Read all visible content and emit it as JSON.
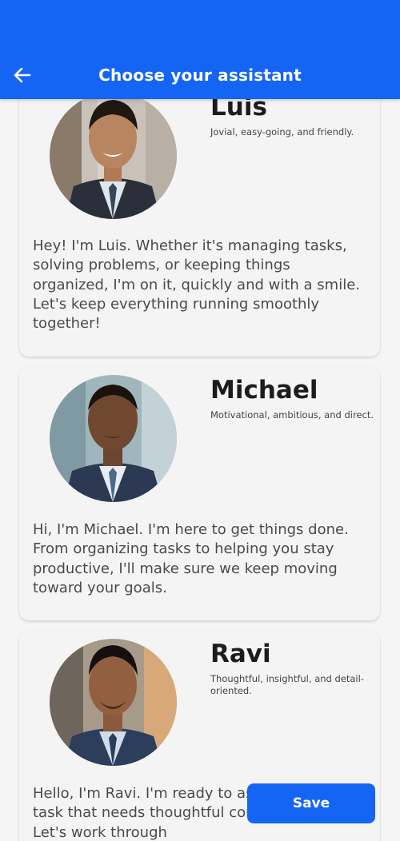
{
  "header": {
    "title": "Choose your assistant",
    "back_icon": "arrow-left-icon"
  },
  "colors": {
    "primary": "#1565f5",
    "background": "#f5f5f5",
    "card": "#f4f4f4"
  },
  "assistants": [
    {
      "name": "Luis",
      "tagline": "Jovial, easy-going, and friendly.",
      "bio": "Hey! I'm Luis. Whether it's managing tasks, solving problems, or keeping things organized, I'm on it, quickly and with a smile. Let's keep everything running smoothly together!"
    },
    {
      "name": "Michael",
      "tagline": "Motivational, ambitious, and direct.",
      "bio": "Hi, I'm Michael. I'm here to get things done. From organizing tasks to helping you stay productive, I'll make sure we keep moving toward your goals."
    },
    {
      "name": "Ravi",
      "tagline": "Thoughtful, insightful, and detail-oriented.",
      "bio": "Hello, I'm Ravi. I'm ready to assist with any task that needs thoughtful consideration. Let's work through"
    }
  ],
  "footer": {
    "save_label": "Save"
  }
}
